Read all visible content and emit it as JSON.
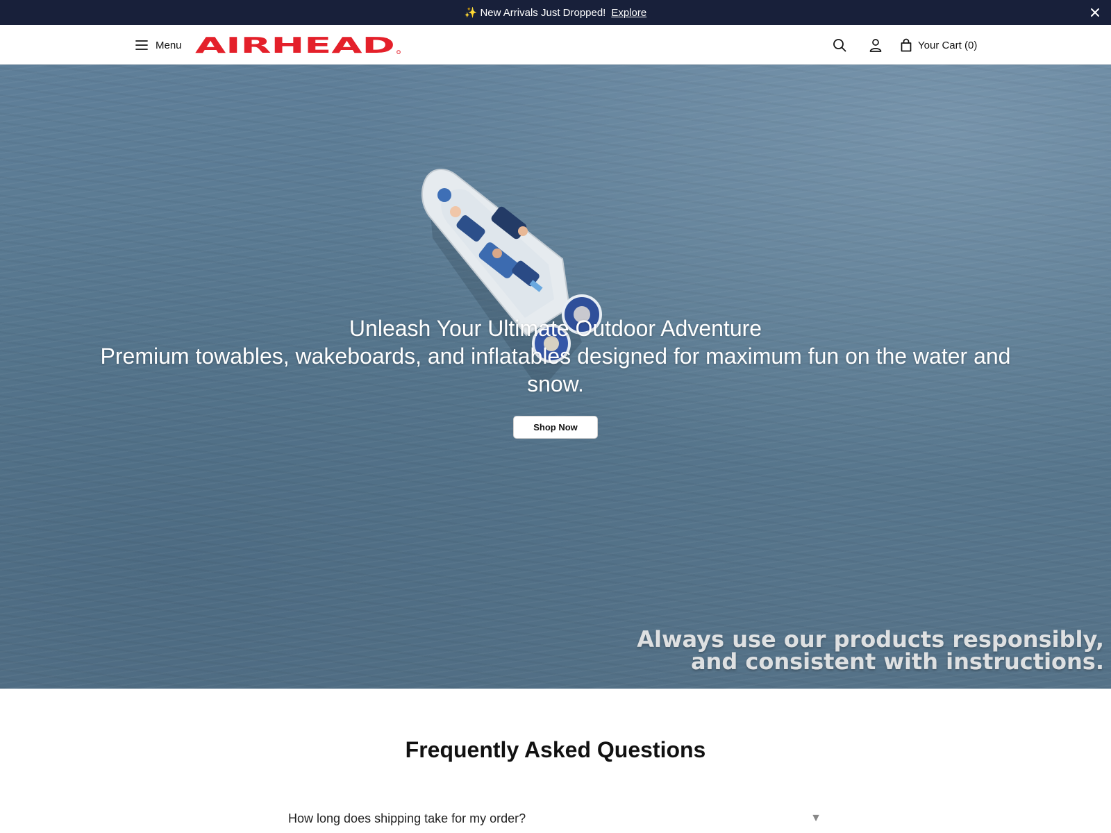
{
  "announcement": {
    "sparkle": "✨",
    "message": "New Arrivals Just Dropped!",
    "link_label": "Explore"
  },
  "header": {
    "menu_label": "Menu",
    "brand": "AIRHEAD",
    "cart_label": "Your Cart (0)"
  },
  "hero": {
    "title": "Unleash Your Ultimate Outdoor Adventure",
    "subtitle": "Premium towables, wakeboards, and inflatables designed for maximum fun on the water and snow.",
    "cta_label": "Shop Now",
    "disclaimer_line1": "Always use our products responsibly,",
    "disclaimer_line2": "and consistent with instructions."
  },
  "faq": {
    "title": "Frequently Asked Questions",
    "items": [
      {
        "question": "How long does shipping take for my order?",
        "arrow": "▼"
      }
    ]
  },
  "colors": {
    "announcement_bg": "#18203a",
    "brand_red": "#e4202a",
    "hero_water": "#5a7a92"
  },
  "icons": [
    "hamburger-icon",
    "search-icon",
    "user-icon",
    "shopping-bag-icon",
    "close-icon",
    "chevron-down-icon"
  ]
}
